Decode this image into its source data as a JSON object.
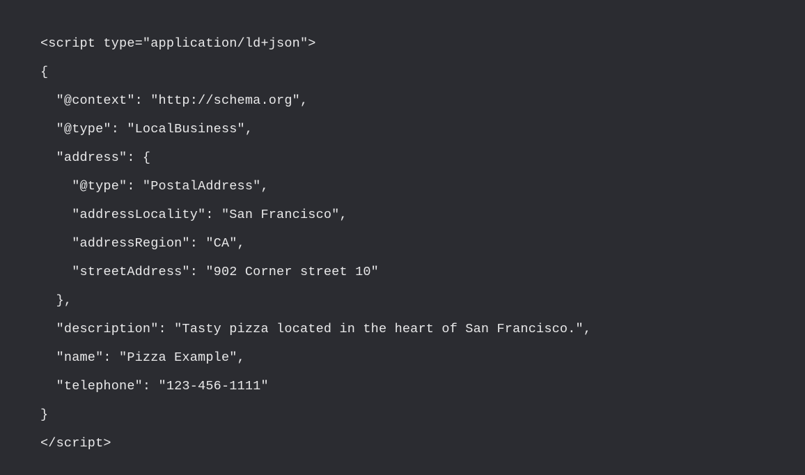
{
  "code": {
    "lines": [
      "<script type=\"application/ld+json\">",
      "{",
      "  \"@context\": \"http://schema.org\",",
      "  \"@type\": \"LocalBusiness\",",
      "  \"address\": {",
      "    \"@type\": \"PostalAddress\",",
      "    \"addressLocality\": \"San Francisco\",",
      "    \"addressRegion\": \"CA\",",
      "    \"streetAddress\": \"902 Corner street 10\"",
      "  },",
      "  \"description\": \"Tasty pizza located in the heart of San Francisco.\",",
      "  \"name\": \"Pizza Example\",",
      "  \"telephone\": \"123-456-1111\"",
      "}",
      "</script>"
    ]
  }
}
